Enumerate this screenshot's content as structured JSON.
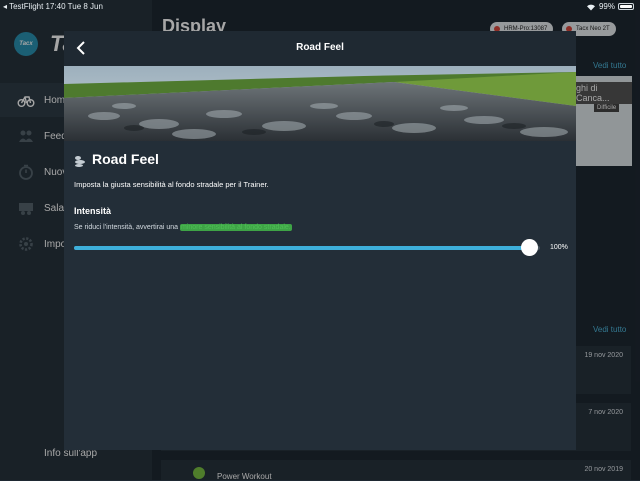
{
  "status_bar": {
    "left": "◂ TestFlight   17:40   Tue 8 Jun",
    "battery": "99%"
  },
  "sidebar": {
    "logo_badge": "Tacx",
    "logo_text": "Ta",
    "items": [
      {
        "label": "Hom",
        "icon": "bike-icon"
      },
      {
        "label": "Feed",
        "icon": "people-icon"
      },
      {
        "label": "Nuov",
        "icon": "stopwatch-icon"
      },
      {
        "label": "Sala",
        "icon": "training-room-icon"
      },
      {
        "label": "Impo",
        "icon": "gear-icon"
      }
    ],
    "footer_label": "Info sull'app"
  },
  "background": {
    "title": "Display",
    "chip_hrm": "HRM-Pro:13087",
    "chip_trainer": "Tacx Neo 2T",
    "see_all_1": "Vedi tutto",
    "see_all_2": "Vedi tutto",
    "thumb_title": "ghi di Canca...",
    "thumb_badge": "Difficile",
    "dates": [
      "19 nov 2020",
      "7 nov 2020",
      "20 nov 2019"
    ],
    "bottom_item": "Power Workout"
  },
  "modal": {
    "title": "Road Feel",
    "section_title": "Road Feel",
    "description": "Imposta la giusta sensibilità al fondo stradale per il Trainer.",
    "intensity_label": "Intensità",
    "hint_prefix": "Se riduci l'intensità, avvertirai una ",
    "hint_highlight": "minore sensibilità al fondo stradale.",
    "slider_value": 100,
    "slider_label": "100%"
  },
  "colors": {
    "accent": "#3eb0db",
    "highlight": "#3ea446"
  }
}
